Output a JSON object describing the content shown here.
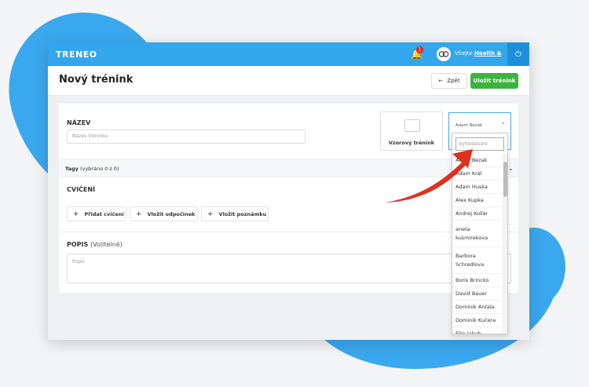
{
  "app": {
    "logo": "TRENEO"
  },
  "header": {
    "notifications_count": "1",
    "greeting": "Vítejte",
    "user": "Health &",
    "chevron": "⌄",
    "power_icon": "⏻"
  },
  "page": {
    "title": "Nový trénink",
    "back_label": "Zpět",
    "save_label": "Uložit trénink"
  },
  "form": {
    "name_label": "NÁZEV",
    "name_placeholder": "Název tréninku",
    "template_label": "Vzorový trénink",
    "tags_label": "Tagy",
    "tags_count": "(vybráno 0 z 0)",
    "exercises_label": "CVIČENÍ",
    "add_exercise": "Přidat cvičení",
    "add_rest": "Vložit odpočinek",
    "add_note": "Vložit poznámku",
    "desc_label": "POPIS",
    "desc_optional": "(Volitelné)",
    "desc_placeholder": "Popis"
  },
  "client_select": {
    "selected": "Adam Bezak",
    "search_placeholder": "Vyhledávání",
    "options": [
      "Adam Bezak",
      "Adam Král",
      "Adam Huska",
      "Alex Kupka",
      "Andrej Kollár",
      "aneta kusmirekova",
      "Barbora Schredlova",
      "Boris Brincko",
      "David Bauer",
      "Dominik Antala",
      "Dominik Kučera",
      "Filip Jakab"
    ]
  },
  "colors": {
    "accent": "#33a6ec",
    "save": "#3cb33c",
    "arrow": "#e0301e"
  }
}
